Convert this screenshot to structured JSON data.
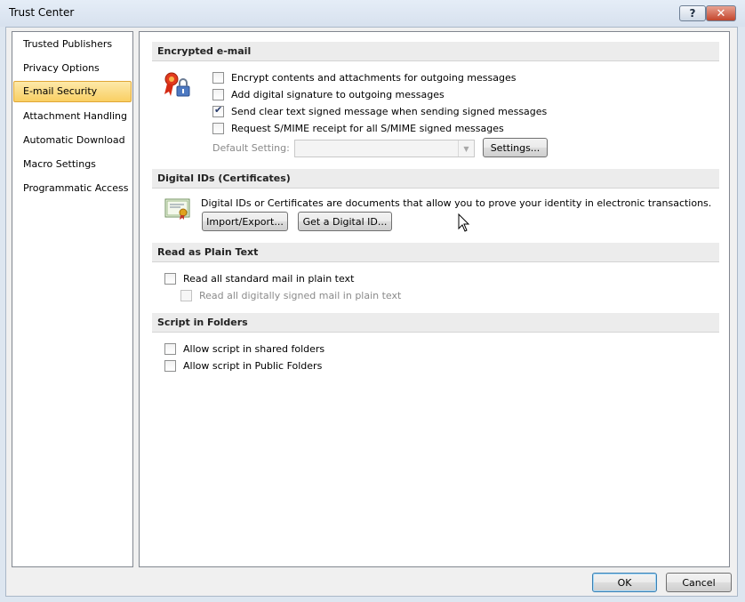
{
  "window": {
    "title": "Trust Center",
    "help": "?",
    "close": "✕"
  },
  "sidebar": {
    "items": [
      {
        "label": "Trusted Publishers"
      },
      {
        "label": "Privacy Options"
      },
      {
        "label": "E-mail Security"
      },
      {
        "label": "Attachment Handling"
      },
      {
        "label": "Automatic Download"
      },
      {
        "label": "Macro Settings"
      },
      {
        "label": "Programmatic Access"
      }
    ],
    "active": "E-mail Security"
  },
  "encrypted": {
    "header": "Encrypted e-mail",
    "options": [
      {
        "label": "Encrypt contents and attachments for outgoing messages",
        "checked": false
      },
      {
        "label": "Add digital signature to outgoing messages",
        "checked": false
      },
      {
        "label": "Send clear text signed message when sending signed messages",
        "checked": true
      },
      {
        "label": "Request S/MIME receipt for all S/MIME signed messages",
        "checked": false
      }
    ],
    "default_setting_label": "Default Setting:",
    "default_setting_value": "",
    "settings_button": "Settings..."
  },
  "digital_ids": {
    "header": "Digital IDs (Certificates)",
    "description": "Digital IDs or Certificates are documents that allow you to prove your identity in electronic transactions.",
    "import_export_button": "Import/Export...",
    "get_id_button": "Get a Digital ID..."
  },
  "plain_text": {
    "header": "Read as Plain Text",
    "read_all": "Read all standard mail in plain text",
    "read_signed": "Read all digitally signed mail in plain text"
  },
  "script": {
    "header": "Script in Folders",
    "shared": "Allow script in shared folders",
    "public": "Allow script in Public Folders"
  },
  "footer": {
    "ok": "OK",
    "cancel": "Cancel"
  },
  "colors": {
    "active_item": "#f9cf63",
    "section_header": "#ececec"
  }
}
